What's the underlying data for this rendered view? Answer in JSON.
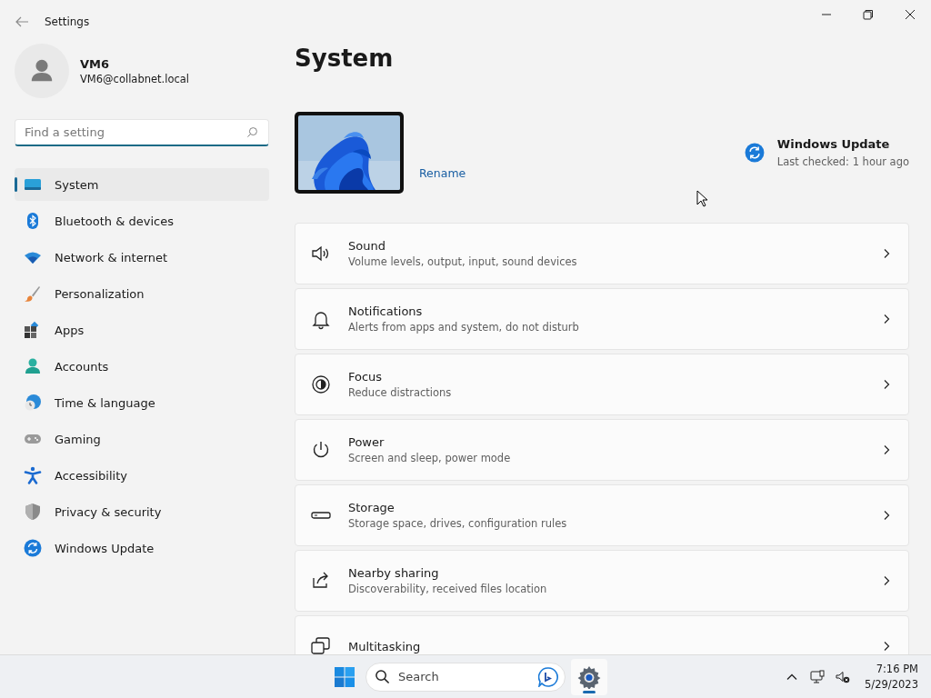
{
  "window": {
    "title": "Settings"
  },
  "account": {
    "name": "VM6",
    "email": "VM6@collabnet.local"
  },
  "search": {
    "placeholder": "Find a setting"
  },
  "sidebar": {
    "items": [
      {
        "label": "System",
        "selected": true
      },
      {
        "label": "Bluetooth & devices",
        "selected": false
      },
      {
        "label": "Network & internet",
        "selected": false
      },
      {
        "label": "Personalization",
        "selected": false
      },
      {
        "label": "Apps",
        "selected": false
      },
      {
        "label": "Accounts",
        "selected": false
      },
      {
        "label": "Time & language",
        "selected": false
      },
      {
        "label": "Gaming",
        "selected": false
      },
      {
        "label": "Accessibility",
        "selected": false
      },
      {
        "label": "Privacy & security",
        "selected": false
      },
      {
        "label": "Windows Update",
        "selected": false
      }
    ]
  },
  "page": {
    "title": "System",
    "device": {
      "rename": "Rename"
    },
    "update": {
      "title": "Windows Update",
      "status": "Last checked: 1 hour ago"
    },
    "cards": [
      {
        "title": "Sound",
        "subtitle": "Volume levels, output, input, sound devices"
      },
      {
        "title": "Notifications",
        "subtitle": "Alerts from apps and system, do not disturb"
      },
      {
        "title": "Focus",
        "subtitle": "Reduce distractions"
      },
      {
        "title": "Power",
        "subtitle": "Screen and sleep, power mode"
      },
      {
        "title": "Storage",
        "subtitle": "Storage space, drives, configuration rules"
      },
      {
        "title": "Nearby sharing",
        "subtitle": "Discoverability, received files location"
      },
      {
        "title": "Multitasking"
      }
    ]
  },
  "taskbar": {
    "search_placeholder": "Search",
    "apps": [
      {
        "kind": "settings",
        "selected": true
      }
    ],
    "time": "7:16 PM",
    "date": "5/29/2023"
  }
}
